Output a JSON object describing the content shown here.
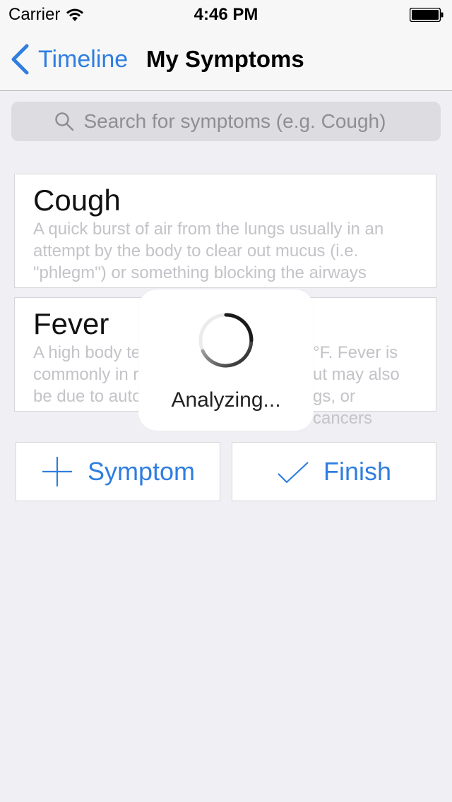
{
  "status_bar": {
    "carrier": "Carrier",
    "time": "4:46 PM",
    "wifi_icon": "wifi-icon",
    "battery_icon": "battery-icon"
  },
  "nav": {
    "back_label": "Timeline",
    "back_icon": "chevron-left-icon",
    "title": "My Symptoms"
  },
  "search": {
    "placeholder": "Search for symptoms (e.g. Cough)",
    "icon": "search-icon"
  },
  "symptoms": [
    {
      "title": "Cough",
      "description": "A quick burst of air from the lungs usually in an attempt by the body to clear out mucus (i.e. \"phlegm\") or something blocking the airways"
    },
    {
      "title": "Fever",
      "description_lines": [
        "A high body te",
        "°F. Fever is",
        "commonly in r",
        "ut may also",
        "be due to auto",
        "gs, or cancers"
      ]
    }
  ],
  "buttons": {
    "add_symptom_label": "Symptom",
    "add_symptom_icon": "plus-icon",
    "finish_label": "Finish",
    "finish_icon": "checkmark-icon"
  },
  "hud": {
    "label": "Analyzing...",
    "icon": "spinner-icon"
  },
  "colors": {
    "accent": "#2f7ee0",
    "background": "#efeff4",
    "card_background": "#ffffff",
    "description_text": "#c3c3c8",
    "search_background": "#dcdce1"
  }
}
